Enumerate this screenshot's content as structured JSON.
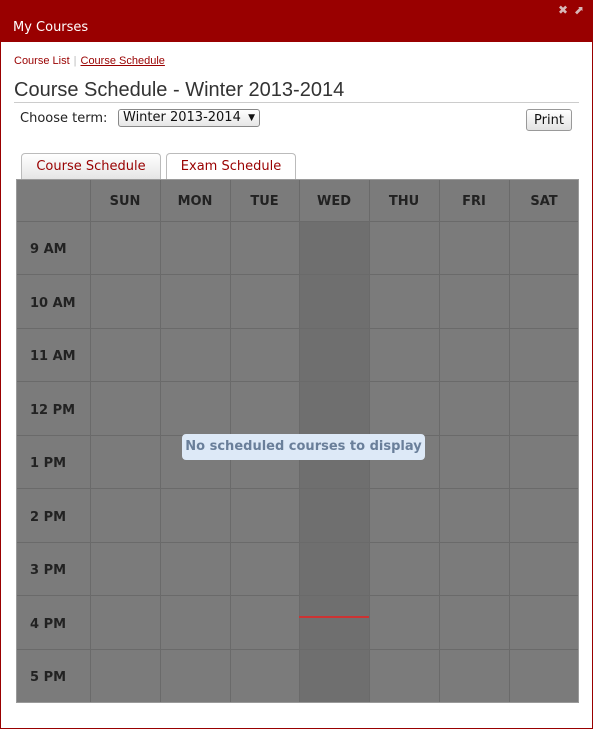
{
  "window": {
    "title": "My Courses",
    "controls": [
      {
        "icon": "close-icon",
        "glyph": "✖"
      },
      {
        "icon": "maximize-icon",
        "glyph": "⬈"
      }
    ]
  },
  "breadcrumb": {
    "course_list": "Course List",
    "course_schedule": "Course Schedule"
  },
  "page_title": "Course Schedule - Winter 2013-2014",
  "term": {
    "label": "Choose term:",
    "selected": "Winter 2013-2014"
  },
  "print_label": "Print",
  "tabs": [
    {
      "label": "Course Schedule"
    },
    {
      "label": "Exam Schedule"
    }
  ],
  "schedule": {
    "days": [
      "SUN",
      "MON",
      "TUE",
      "WED",
      "THU",
      "FRI",
      "SAT"
    ],
    "times": [
      "9 AM",
      "10 AM",
      "11 AM",
      "12 PM",
      "1 PM",
      "2 PM",
      "3 PM",
      "4 PM",
      "5 PM"
    ],
    "empty_message": "No scheduled courses to display"
  },
  "colors": {
    "brand": "#990000",
    "grid_overlay": "#7b7b7b",
    "current_day": "#6f6f6f",
    "now_marker": "#cc3333"
  }
}
